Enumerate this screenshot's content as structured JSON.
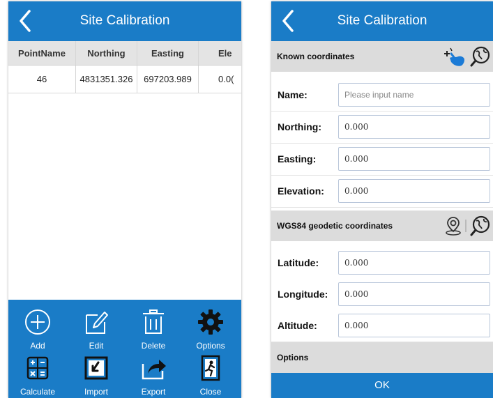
{
  "left": {
    "title": "Site Calibration",
    "table": {
      "headers": [
        "PointName",
        "Northing",
        "Easting",
        "Ele"
      ],
      "rows": [
        [
          "46",
          "4831351.326",
          "697203.989",
          "0.0("
        ]
      ]
    },
    "toolbar": [
      {
        "label": "Add",
        "icon": "plus-circle-icon"
      },
      {
        "label": "Edit",
        "icon": "edit-icon"
      },
      {
        "label": "Delete",
        "icon": "trash-icon"
      },
      {
        "label": "Options",
        "icon": "gear-icon"
      },
      {
        "label": "Calculate",
        "icon": "calculator-icon"
      },
      {
        "label": "Import",
        "icon": "import-icon"
      },
      {
        "label": "Export",
        "icon": "export-icon"
      },
      {
        "label": "Close",
        "icon": "exit-icon"
      }
    ]
  },
  "right": {
    "title": "Site Calibration",
    "known": {
      "title": "Known coordinates",
      "fields": [
        {
          "label": "Name:",
          "value": "",
          "placeholder": "Please input name"
        },
        {
          "label": "Northing:",
          "value": "0.000",
          "placeholder": ""
        },
        {
          "label": "Easting:",
          "value": "0.000",
          "placeholder": ""
        },
        {
          "label": "Elevation:",
          "value": "0.000",
          "placeholder": ""
        }
      ]
    },
    "wgs": {
      "title": "WGS84 geodetic coordinates",
      "fields": [
        {
          "label": "Latitude:",
          "value": "0.000",
          "placeholder": ""
        },
        {
          "label": "Longitude:",
          "value": "0.000",
          "placeholder": ""
        },
        {
          "label": "Altitude:",
          "value": "0.000",
          "placeholder": ""
        }
      ]
    },
    "options_title": "Options",
    "ok_label": "OK"
  },
  "colors": {
    "accent": "#1a7cc7",
    "header_gray": "#dcdcdc"
  }
}
